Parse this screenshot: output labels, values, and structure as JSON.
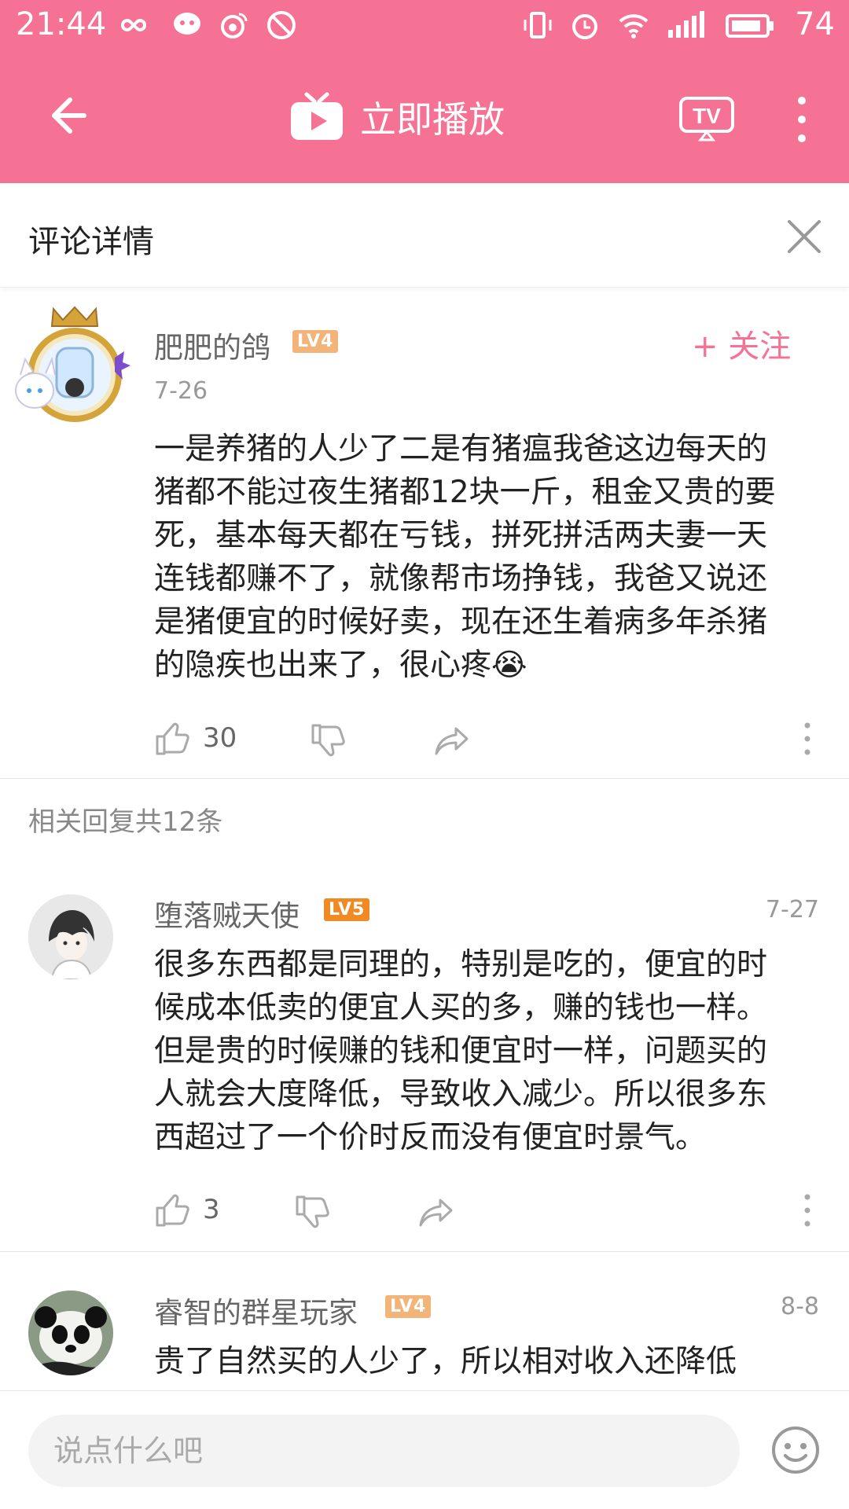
{
  "status_bar": {
    "time": "21:44",
    "battery": "74"
  },
  "app_bar": {
    "title": "立即播放"
  },
  "subheader": {
    "title": "评论详情"
  },
  "main_comment": {
    "username": "肥肥的鸽",
    "level": "LV4",
    "date": "7-26",
    "follow_label": "+ 关注",
    "lines": [
      "一是养猪的人少了二是有猪瘟我爸这边每天的",
      "猪都不能过夜生猪都12块一斤，租金又贵的要",
      "死，基本每天都在亏钱，拼死拼活两夫妻一天",
      "连钱都赚不了，就像帮市场挣钱，我爸又说还",
      "是猪便宜的时候好卖，现在还生着病多年杀猪",
      "的隐疾也出来了，很心疼😭"
    ],
    "likes": "30"
  },
  "replies_count": "相关回复共12条",
  "replies": [
    {
      "username": "堕落贼天使",
      "level": "LV5",
      "date": "7-27",
      "lines": [
        "很多东西都是同理的，特别是吃的，便宜的时",
        "候成本低卖的便宜人买的多，赚的钱也一样。",
        "但是贵的时候赚的钱和便宜时一样，问题买的",
        "人就会大度降低，导致收入减少。所以很多东",
        "西超过了一个价时反而没有便宜时景气。"
      ],
      "likes": "3"
    },
    {
      "username": "睿智的群星玩家",
      "level": "LV4",
      "date": "8-8",
      "lines": [
        "贵了自然买的人少了，所以相对收入还降低"
      ]
    }
  ],
  "input_bar": {
    "placeholder": "说点什么吧"
  },
  "colors": {
    "accent": "#f67295",
    "lv4": "#f3b47a",
    "lv5": "#f08a24"
  }
}
